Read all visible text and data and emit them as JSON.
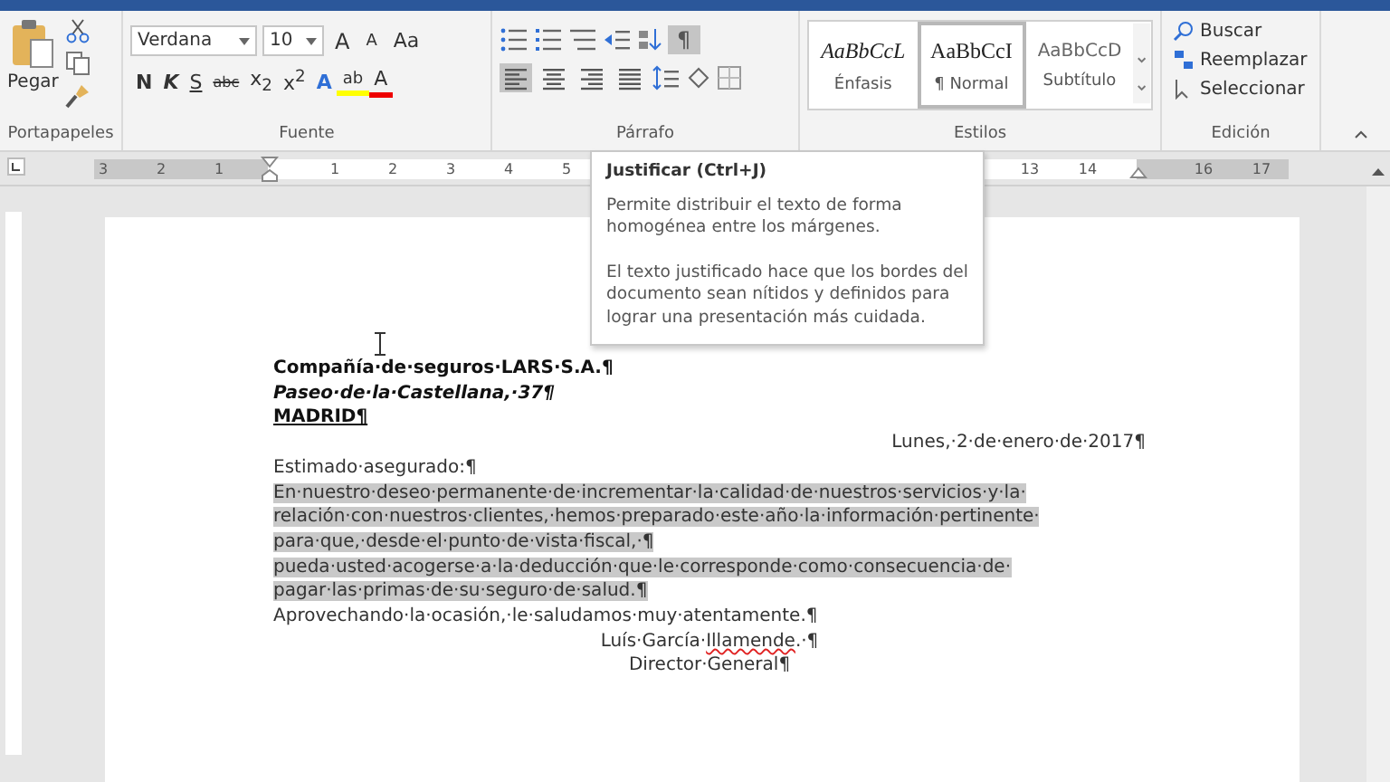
{
  "ribbon": {
    "clipboard": {
      "label": "Portapapeles",
      "paste": "Pegar"
    },
    "font": {
      "label": "Fuente",
      "name": "Verdana",
      "size": "10",
      "row1": [
        {
          "kind": "grow",
          "text": "A"
        },
        {
          "kind": "shrink",
          "text": "A"
        },
        {
          "kind": "case",
          "text": "Aa"
        }
      ],
      "row2": [
        {
          "kind": "bold",
          "text": "N"
        },
        {
          "kind": "italic",
          "text": "K"
        },
        {
          "kind": "underline",
          "text": "S"
        },
        {
          "kind": "strike",
          "text": "abc"
        },
        {
          "kind": "sub",
          "text": "x$_{2}$"
        },
        {
          "kind": "sup",
          "text": "x$^{2}$"
        },
        {
          "kind": "effects",
          "text": "A"
        },
        {
          "kind": "highlight",
          "text": "ab"
        },
        {
          "kind": "color",
          "text": "A"
        }
      ]
    },
    "paragraph": {
      "label": "Párrafo",
      "show_marks": {
        "text": "¶",
        "selected": true
      },
      "align": [
        {
          "kind": "left",
          "selected": true
        },
        {
          "kind": "center",
          "selected": false
        },
        {
          "kind": "right",
          "selected": false
        },
        {
          "kind": "justify",
          "selected": false
        }
      ]
    },
    "styles": {
      "label": "Estilos",
      "items": [
        {
          "kind": "emphasis",
          "sample": "AaBbCcL",
          "name": "Énfasis",
          "selected": false
        },
        {
          "kind": "normal",
          "sample": "AaBbCcI",
          "name": "¶ Normal",
          "selected": true
        },
        {
          "kind": "subtitle",
          "sample": "AaBbCcD",
          "name": "Subtítulo",
          "selected": false
        }
      ]
    },
    "editing": {
      "label": "Edición",
      "items": [
        {
          "kind": "find",
          "text": "Buscar"
        },
        {
          "kind": "replace",
          "text": "Reemplazar"
        },
        {
          "kind": "select",
          "text": "Seleccionar"
        }
      ]
    }
  },
  "ruler": {
    "segments": [
      [
        "3",
        "2",
        "1"
      ],
      [
        "1",
        "2",
        "3",
        "4",
        "5"
      ],
      [
        "13",
        "14"
      ],
      [
        "16",
        "17"
      ]
    ]
  },
  "tooltip": {
    "title": "Justificar (Ctrl+J)",
    "paragraphs": [
      [
        "Permite distribuir el texto de forma",
        "homogénea entre los márgenes."
      ],
      [
        "El texto justificado hace que los bordes del",
        "documento sean nítidos y definidos para",
        "lograr una presentación más cuidada."
      ]
    ]
  },
  "document": {
    "lines": [
      {
        "text": "Compañía·de·seguros·LARS·S.A.¶",
        "kind": "company",
        "selected": false
      },
      {
        "text": "Paseo·de·la·Castellana,·37¶",
        "kind": "street",
        "selected": false
      },
      {
        "text": "MADRID¶",
        "kind": "city",
        "selected": false
      },
      {
        "text": "Lunes,·2·de·enero·de·2017¶",
        "kind": "date",
        "selected": false
      },
      {
        "text": "Estimado·asegurado:¶",
        "kind": "body",
        "selected": false
      },
      {
        "text": "En·nuestro·deseo·permanente·de·incrementar·la·calidad·de·nuestros·servicios·y·la·",
        "kind": "body",
        "selected": true
      },
      {
        "text": "relación·con·nuestros·clientes,·hemos·preparado·este·año·la·información·pertinente·",
        "kind": "body",
        "selected": true
      },
      {
        "text": "para·que,·desde·el·punto·de·vista·fiscal,·¶",
        "kind": "body",
        "selected": true
      },
      {
        "text": "pueda·usted·acogerse·a·la·deducción·que·le·corresponde·como·consecuencia·de·",
        "kind": "body",
        "selected": true
      },
      {
        "text": "pagar·las·primas·de·su·seguro·de·salud.¶",
        "kind": "body",
        "selected": true
      },
      {
        "text": "Aprovechando·la·ocasión,·le·saludamos·muy·atentamente.¶",
        "kind": "body",
        "selected": false
      },
      {
        "parts": [
          {
            "text": "Luís·García·",
            "misspelled": false
          },
          {
            "text": "Illamende",
            "misspelled": true
          },
          {
            "text": ".·¶",
            "misspelled": false
          }
        ],
        "kind": "signature",
        "selected": false
      },
      {
        "text": "Director·General¶",
        "kind": "signature",
        "selected": false
      }
    ]
  }
}
